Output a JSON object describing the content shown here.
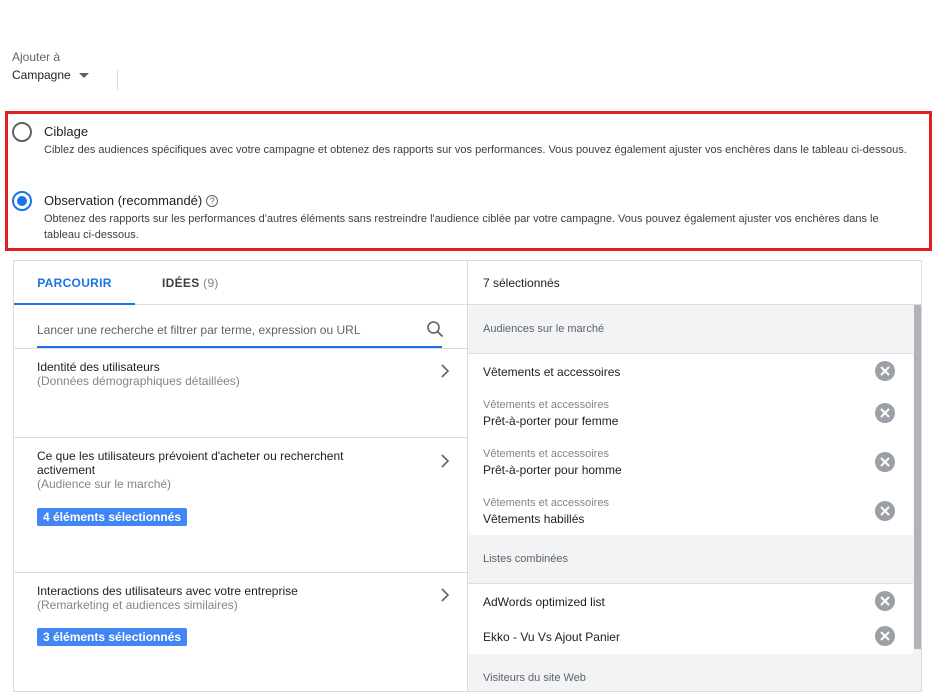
{
  "add_to": {
    "label": "Ajouter à",
    "value": "Campagne"
  },
  "mode": {
    "options": [
      {
        "title": "Ciblage",
        "description": "Ciblez des audiences spécifiques avec votre campagne et obtenez des rapports sur vos performances. Vous pouvez également ajuster vos enchères dans le tableau ci-dessous.",
        "selected": false
      },
      {
        "title": "Observation (recommandé)",
        "description": "Obtenez des rapports sur les performances d'autres éléments sans restreindre l'audience ciblée par votre campagne. Vous pouvez également ajuster vos enchères dans le tableau ci-dessous.",
        "selected": true
      }
    ]
  },
  "tabs": {
    "browse": "PARCOURIR",
    "ideas": "IDÉES",
    "ideas_count": "(9)"
  },
  "search": {
    "placeholder": "Lancer une recherche et filtrer par terme, expression ou URL",
    "value": ""
  },
  "categories": [
    {
      "title": "Identité des utilisateurs",
      "subtitle": "(Données démographiques détaillées)",
      "badge": ""
    },
    {
      "title": "Ce que les utilisateurs prévoient d'acheter ou recherchent activement",
      "subtitle": "(Audience sur le marché)",
      "badge": "4 éléments sélectionnés"
    },
    {
      "title": "Interactions des utilisateurs avec votre entreprise",
      "subtitle": "(Remarketing et audiences similaires)",
      "badge": "3 éléments sélectionnés"
    }
  ],
  "selected": {
    "header": "7 sélectionnés",
    "groups": [
      {
        "title": "Audiences sur le marché",
        "items": [
          {
            "parent": "",
            "name": "Vêtements et accessoires"
          },
          {
            "parent": "Vêtements et accessoires",
            "name": "Prêt-à-porter pour femme"
          },
          {
            "parent": "Vêtements et accessoires",
            "name": "Prêt-à-porter pour homme"
          },
          {
            "parent": "Vêtements et accessoires",
            "name": "Vêtements habillés"
          }
        ]
      },
      {
        "title": "Listes combinées",
        "items": [
          {
            "parent": "",
            "name": "AdWords optimized list"
          },
          {
            "parent": "",
            "name": "Ekko - Vu Vs Ajout Panier"
          }
        ]
      },
      {
        "title": "Visiteurs du site Web",
        "items": []
      }
    ]
  },
  "colors": {
    "accent": "#1a73e8",
    "badge": "#4285f4",
    "highlight_border": "#e02020"
  },
  "icons": {
    "dropdown": "caret-down-icon",
    "help": "help-circle-icon",
    "search": "search-icon",
    "chevron": "chevron-right-icon",
    "remove": "remove-circle-icon"
  }
}
